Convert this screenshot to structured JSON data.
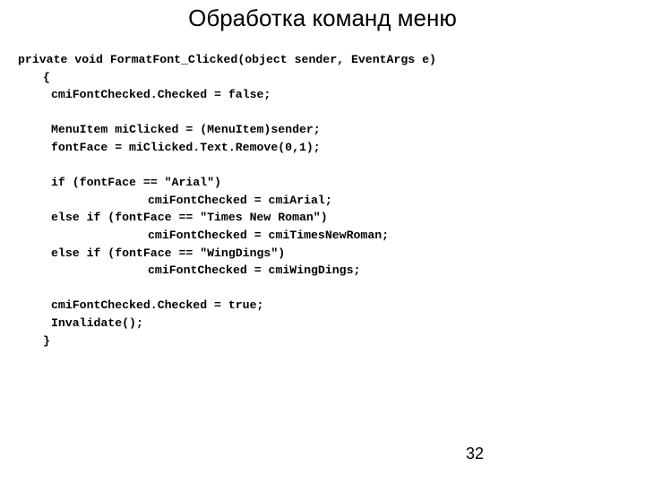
{
  "slide": {
    "title": "Обработка команд меню",
    "page_number": "32"
  },
  "code": {
    "lines": [
      "private void FormatFont_Clicked(object sender, EventArgs e)",
      "{",
      "cmiFontChecked.Checked = false;",
      "MenuItem miClicked = (MenuItem)sender;",
      "fontFace = miClicked.Text.Remove(0,1);",
      "if (fontFace == \"Arial\")",
      "cmiFontChecked = cmiArial;",
      "else if (fontFace == \"Times New Roman\")",
      "cmiFontChecked = cmiTimesNewRoman;",
      "else if (fontFace == \"WingDings\")",
      "cmiFontChecked = cmiWingDings;",
      "cmiFontChecked.Checked = true;",
      "Invalidate();",
      "}"
    ]
  }
}
